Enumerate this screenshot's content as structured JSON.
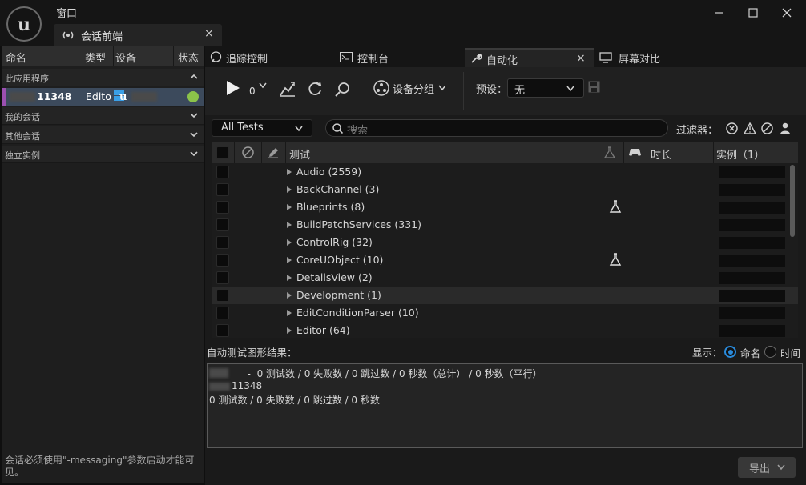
{
  "window": {
    "menu_label": "窗口",
    "doc_tab_label": "会话前端",
    "doc_tab_close": "×"
  },
  "sessions_panel": {
    "columns": [
      "命名",
      "类型",
      "设备",
      "状态"
    ],
    "groups": [
      {
        "label": "此应用程序",
        "expanded": true
      },
      {
        "label": "我的会话",
        "expanded": false
      },
      {
        "label": "其他会话",
        "expanded": false
      },
      {
        "label": "独立实例",
        "expanded": false
      }
    ],
    "session": {
      "id": "11348",
      "type": "Edito",
      "status_color": "#8bc34a"
    },
    "footer_note": "会话必须使用\"-messaging\"参数启动才能可见。"
  },
  "tabs": [
    {
      "label": "追踪控制",
      "icon": "chat-bubble-icon"
    },
    {
      "label": "控制台",
      "icon": "console-icon"
    },
    {
      "label": "自动化",
      "icon": "wrench-icon",
      "active": true,
      "close": "×"
    },
    {
      "label": "屏幕对比",
      "icon": "monitor-icon"
    }
  ],
  "toolbar": {
    "run_count": "0",
    "device_group_label": "设备分组",
    "preset_label": "预设：",
    "preset_value": "无"
  },
  "filter_bar": {
    "all_tests_label": "All Tests",
    "search_placeholder": "搜索",
    "filter_label": "过滤器："
  },
  "test_grid": {
    "columns": {
      "test": "测试",
      "duration": "时长",
      "instance": "实例（1）"
    },
    "rows": [
      {
        "name": "Audio (2559)",
        "flask": false
      },
      {
        "name": "BackChannel (3)",
        "flask": false
      },
      {
        "name": "Blueprints (8)",
        "flask": true
      },
      {
        "name": "BuildPatchServices (331)",
        "flask": false
      },
      {
        "name": "ControlRig (32)",
        "flask": false
      },
      {
        "name": "CoreUObject (10)",
        "flask": true
      },
      {
        "name": "DetailsView (2)",
        "flask": false
      },
      {
        "name": "Development (1)",
        "flask": false,
        "highlighted": true
      },
      {
        "name": "EditConditionParser (10)",
        "flask": false
      },
      {
        "name": "Editor (64)",
        "flask": false
      }
    ]
  },
  "results": {
    "title": "自动测试图形结果：",
    "display_label": "显示：",
    "option_name": "命名",
    "option_time": "时间",
    "line1": "  -  0 测试数 / 0 失败数 / 0 跳过数 / 0 秒数（总计） / 0 秒数（平行）",
    "line2": "11348",
    "line3": "0 测试数 / 0 失败数 / 0 跳过数 / 0 秒数",
    "export_label": "导出"
  }
}
